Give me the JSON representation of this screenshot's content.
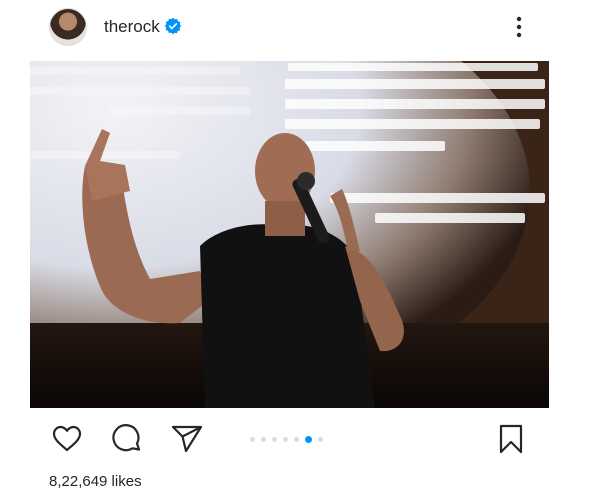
{
  "post": {
    "username": "therock",
    "verified": true,
    "likes_text": "8,22,649 likes",
    "carousel": {
      "count": 7,
      "active_index": 5
    }
  },
  "icons": {
    "verified": "verified-badge-icon",
    "more": "more-options-icon",
    "like": "heart-icon",
    "comment": "comment-icon",
    "share": "share-icon",
    "save": "bookmark-icon"
  },
  "colors": {
    "text": "#262626",
    "accent": "#0095f6",
    "dot_inactive": "#dbdbdb"
  }
}
